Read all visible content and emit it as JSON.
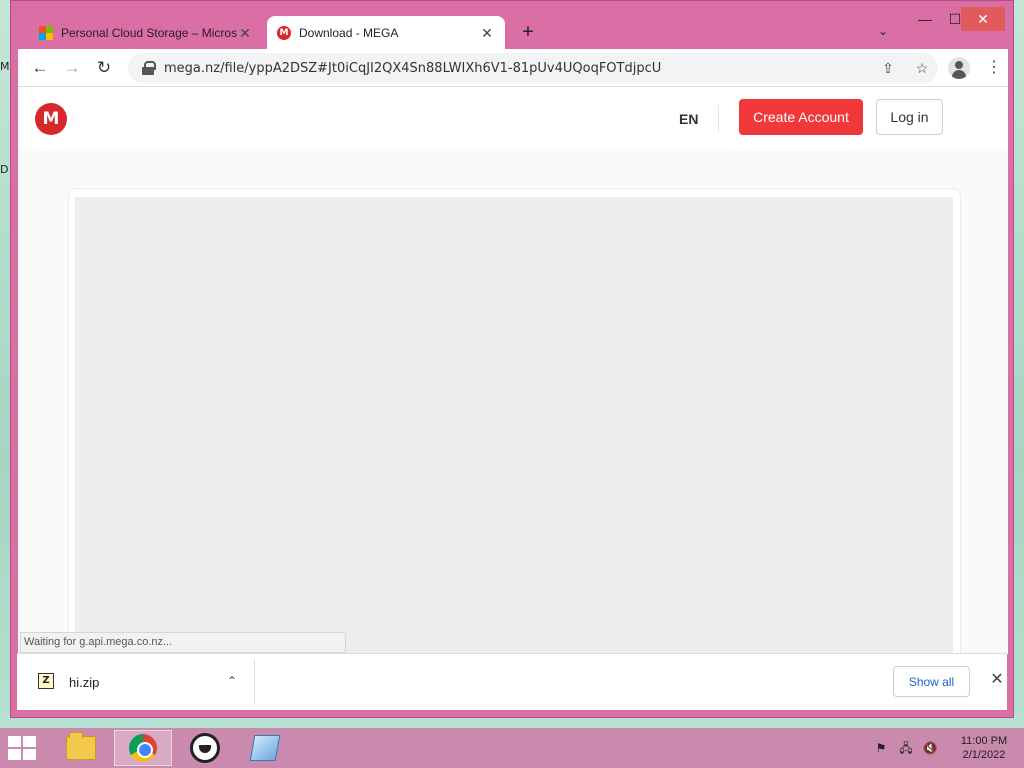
{
  "desktop": {
    "edge_top": "M",
    "edge_mid": "D"
  },
  "browser": {
    "tabs": [
      {
        "title": "Personal Cloud Storage – Micros",
        "active": false
      },
      {
        "title": "Download - MEGA",
        "active": true
      }
    ],
    "new_tab_symbol": "+",
    "url": "mega.nz/file/yppA2DSZ#Jt0iCqJI2QX4Sn88LWIXh6V1-81pUv4UQoqFOTdjpcU"
  },
  "mega": {
    "logo_letter": "M",
    "language": "EN",
    "create_account_label": "Create Account",
    "login_label": "Log in"
  },
  "status": {
    "text": "Waiting for g.api.mega.co.nz..."
  },
  "downloads": {
    "file_name": "hi.zip",
    "zip_letter": "Z",
    "show_all_label": "Show all"
  },
  "taskbar": {
    "time": "11:00 PM",
    "date": "2/1/2022"
  },
  "icons": {
    "window": [
      "minimize-icon",
      "maximize-icon",
      "close-icon"
    ],
    "toolbar": [
      "back-arrow-icon",
      "forward-arrow-icon",
      "reload-icon",
      "lock-icon",
      "share-icon",
      "star-icon",
      "profile-icon",
      "menu-icon"
    ],
    "taskbar": [
      "windows-logo-icon",
      "folder-icon",
      "chrome-icon",
      "app-icon",
      "paint-icon",
      "flag-icon",
      "network-icon",
      "volume-muted-icon"
    ]
  },
  "colors": {
    "window_frame": "#da6fa6",
    "mega_red": "#d9272e",
    "create_account_bg": "#f0373a",
    "show_all_text": "#1a63c7",
    "taskbar": "#c98aae"
  }
}
